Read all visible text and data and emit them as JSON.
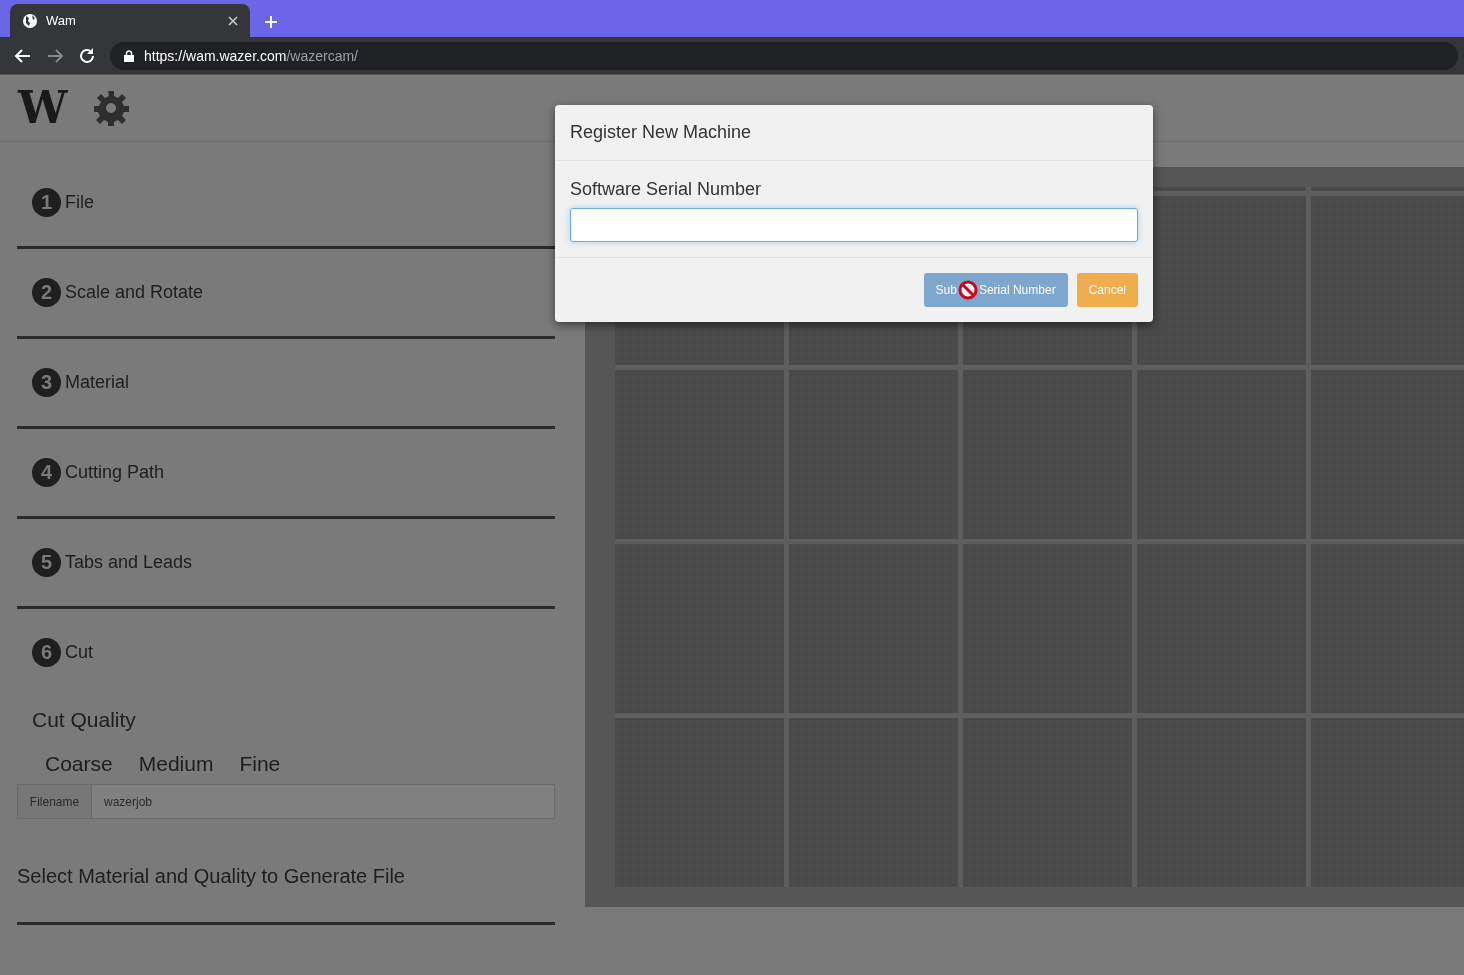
{
  "logo": "W",
  "browser": {
    "tab": {
      "title": "Wam"
    },
    "url": {
      "host": "https://wam.wazer.com",
      "path": "/wazercam/"
    }
  },
  "steps": [
    {
      "number": "1",
      "label": "File"
    },
    {
      "number": "2",
      "label": "Scale and Rotate"
    },
    {
      "number": "3",
      "label": "Material"
    },
    {
      "number": "4",
      "label": "Cutting Path"
    },
    {
      "number": "5",
      "label": "Tabs and Leads"
    },
    {
      "number": "6",
      "label": "Cut"
    }
  ],
  "cut_quality": {
    "title": "Cut Quality",
    "options": [
      "Coarse",
      "Medium",
      "Fine"
    ]
  },
  "filename": {
    "label": "Filename",
    "value": "wazerjob"
  },
  "status": "Select Material and Quality to Generate File",
  "dialog": {
    "title": "Register New Machine",
    "field_label": "Software Serial Number",
    "buttons": [
      {
        "kind": "submit",
        "label_start": "Sub",
        "label_end": "Serial Number"
      },
      {
        "kind": "cancel",
        "label": "Cancel"
      }
    ]
  }
}
